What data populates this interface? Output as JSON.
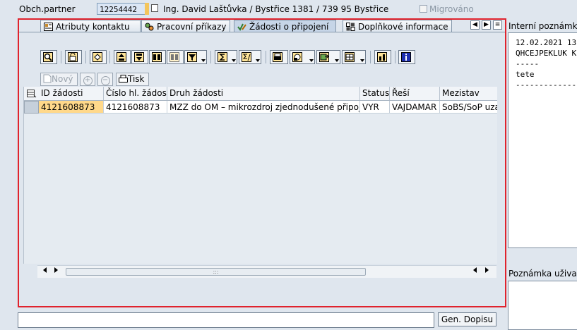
{
  "header": {
    "partner_label": "Obch.partner",
    "partner_id": "12254442",
    "partner_name": "Ing. David Laštůvka / Bystřice 1381 / 739 95 Bystřice",
    "migrated_label": "Migrováno"
  },
  "tabs": [
    {
      "label": "Atributy kontaktu",
      "icon": "contact-card-icon"
    },
    {
      "label": "Pracovní příkazy",
      "icon": "work-orders-icon"
    },
    {
      "label": "Žádosti o připojení",
      "icon": "check-pencil-icon"
    },
    {
      "label": "Doplňkové informace",
      "icon": "grid-info-icon"
    }
  ],
  "actions": {
    "new_label": "Nový",
    "print_label": "Tisk"
  },
  "grid": {
    "columns": [
      "ID žádosti",
      "Číslo hl. žádosti",
      "Druh žádosti",
      "Status",
      "Řeší",
      "Mezistav"
    ],
    "rows": [
      [
        "4121608873",
        "4121608873",
        "MZZ do OM – mikrozdroj zjednodušené připojení",
        "VYR",
        "VAJDAMAR",
        "SoBS/SoP uzav"
      ]
    ]
  },
  "right_panel": {
    "internal_note_title": "Interní poznámka",
    "internal_note_text": "12.02.2021 13\nQHCEJPEKLUK K\n-----\ntete\n--------------",
    "user_note_title": "Poznámka uživatel"
  },
  "bottom": {
    "gen_button_label": "Gen. Dopisu"
  },
  "colors": {
    "frame": "#e0232d",
    "highlight": "#ffd88a",
    "background": "#dfe6ee"
  }
}
